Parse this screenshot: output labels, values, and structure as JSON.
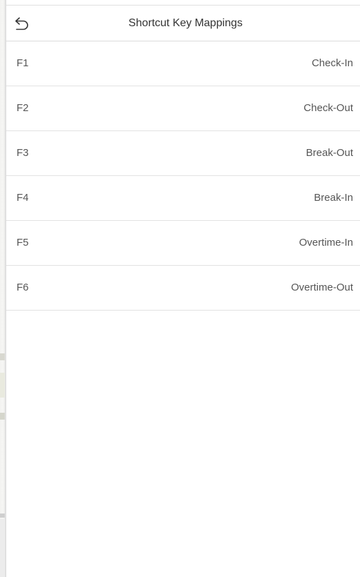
{
  "header": {
    "title": "Shortcut Key Mappings",
    "back_icon": "back-arrow-icon"
  },
  "mappings": [
    {
      "key": "F1",
      "action": "Check-In"
    },
    {
      "key": "F2",
      "action": "Check-Out"
    },
    {
      "key": "F3",
      "action": "Break-Out"
    },
    {
      "key": "F4",
      "action": "Break-In"
    },
    {
      "key": "F5",
      "action": "Overtime-In"
    },
    {
      "key": "F6",
      "action": "Overtime-Out"
    }
  ],
  "colors": {
    "text": "#555555",
    "title": "#333333",
    "divider": "#e2e2e2",
    "background": "#ffffff"
  }
}
